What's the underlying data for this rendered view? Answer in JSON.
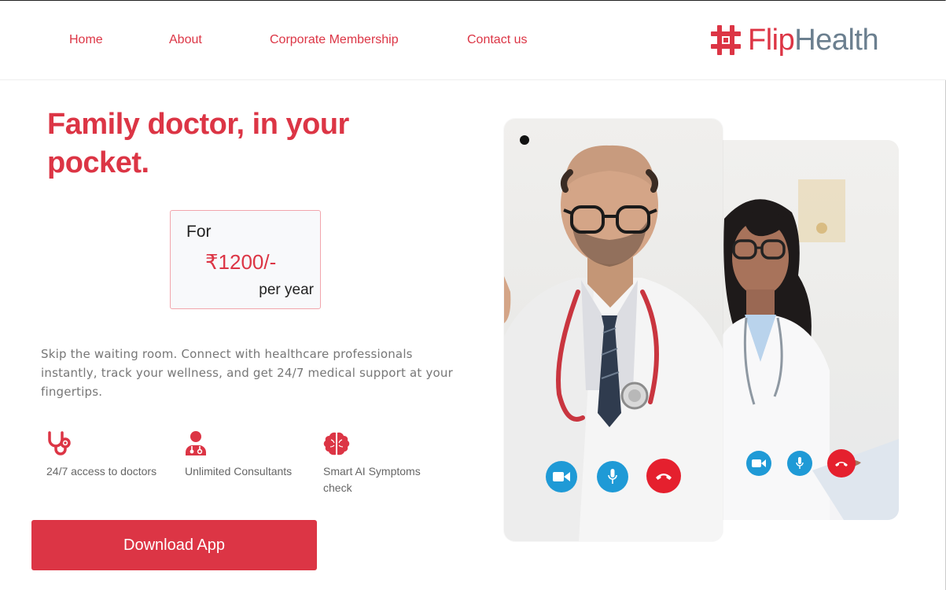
{
  "nav": {
    "links": [
      "Home",
      "About",
      "Corporate Membership",
      "Contact us"
    ]
  },
  "logo": {
    "part1": "Flip",
    "part2": "Health"
  },
  "hero": {
    "title": "Family doctor, in your pocket.",
    "price": {
      "prefix": "For",
      "amount": "₹1200/-",
      "period": "per year"
    },
    "description": "Skip the waiting room. Connect with healthcare professionals instantly, track your wellness, and get 24/7 medical support at your fingertips."
  },
  "features": [
    {
      "icon": "stethoscope-icon",
      "label": "24/7 access to doctors"
    },
    {
      "icon": "doctor-icon",
      "label": "Unlimited Consultants"
    },
    {
      "icon": "brain-icon",
      "label": "Smart AI Symptoms check"
    }
  ],
  "cta": {
    "download": "Download App"
  },
  "colors": {
    "brand_red": "#dc3545",
    "logo_gray": "#6b7f8f",
    "video_blue": "#1f9ad6",
    "hangup_red": "#e5202e"
  },
  "call_controls": [
    "video-camera-icon",
    "microphone-icon",
    "hang-up-icon"
  ]
}
